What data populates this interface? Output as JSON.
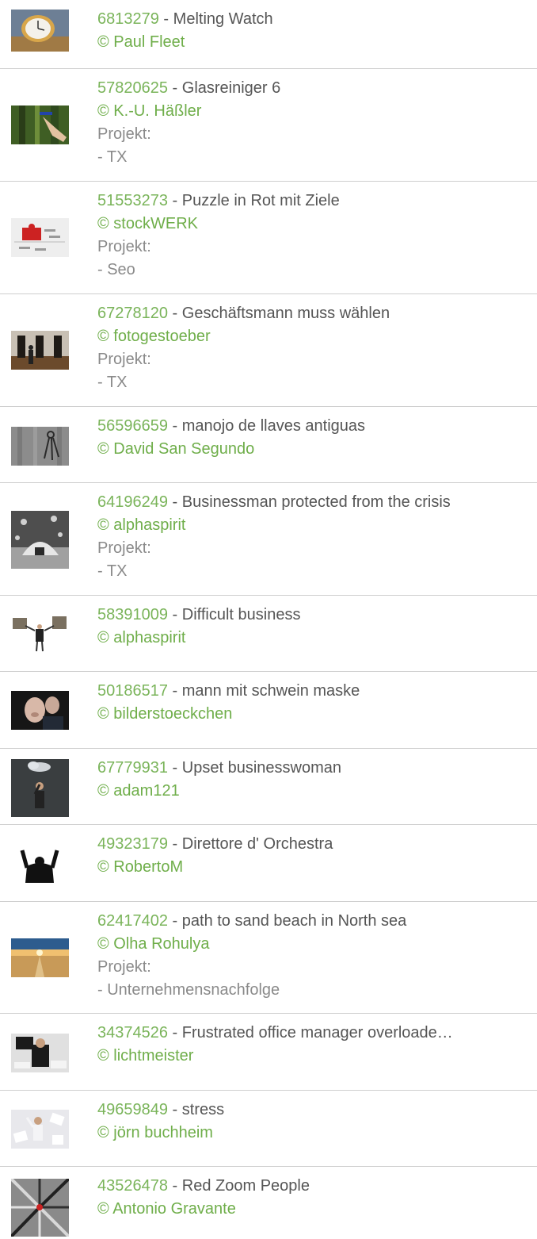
{
  "items": [
    {
      "id": "6813279",
      "title": "Melting Watch",
      "author": "© Paul Fleet",
      "icon": "melting-watch-thumbnail",
      "colors": [
        "#c9a66b",
        "#8a6a3a"
      ]
    },
    {
      "id": "57820625",
      "title": "Glasreiniger 6",
      "author": "© K.-U. Häßler",
      "project_label": "Projekt:",
      "project": "- TX",
      "icon": "glass-cleaner-thumbnail",
      "colors": [
        "#2f4a1e",
        "#6f8d3a"
      ]
    },
    {
      "id": "51553273",
      "title": "Puzzle in Rot mit Ziele",
      "author": "© stockWERK",
      "project_label": "Projekt:",
      "project": "- Seo",
      "icon": "puzzle-thumbnail",
      "colors": [
        "#eeeeee",
        "#cc2222"
      ]
    },
    {
      "id": "67278120",
      "title": "Geschäftsmann muss wählen",
      "author": "© fotogestoeber",
      "project_label": "Projekt:",
      "project": "- TX",
      "icon": "doors-thumbnail",
      "colors": [
        "#6b5a48",
        "#2a2520"
      ]
    },
    {
      "id": "56596659",
      "title": "manojo de llaves antiguas",
      "author": "© David San Segundo",
      "icon": "keys-thumbnail",
      "colors": [
        "#8c8c8c",
        "#3c3c3c"
      ]
    },
    {
      "id": "64196249",
      "title": "Businessman protected from the crisis",
      "author": "© alphaspirit",
      "project_label": "Projekt:",
      "project": "- TX",
      "icon": "businessman-shield-thumbnail",
      "colors": [
        "#5a5a5a",
        "#c8c8c8"
      ]
    },
    {
      "id": "58391009",
      "title": "Difficult business",
      "author": "© alphaspirit",
      "icon": "stones-thumbnail",
      "colors": [
        "#ffffff",
        "#7a7060"
      ]
    },
    {
      "id": "50186517",
      "title": "mann mit schwein maske",
      "author": "© bilderstoeckchen",
      "icon": "pig-mask-thumbnail",
      "colors": [
        "#1a1a1a",
        "#d8b8a8"
      ]
    },
    {
      "id": "67779931",
      "title": "Upset businesswoman",
      "author": "© adam121",
      "icon": "businesswoman-cloud-thumbnail",
      "colors": [
        "#3a3e40",
        "#d0d4d8"
      ]
    },
    {
      "id": "49323179",
      "title": "Direttore d' Orchestra",
      "author": "© RobertoM",
      "icon": "conductor-thumbnail",
      "colors": [
        "#ffffff",
        "#111111"
      ]
    },
    {
      "id": "62417402",
      "title": "path to sand beach in North sea",
      "author": "© Olha Rohulya",
      "project_label": "Projekt:",
      "project": "- Unternehmensnachfolge",
      "icon": "beach-thumbnail",
      "colors": [
        "#2d5c8e",
        "#d9b070"
      ]
    },
    {
      "id": "34374526",
      "title": "Frustrated office manager overloade…",
      "author": "© lichtmeister",
      "icon": "office-manager-thumbnail",
      "colors": [
        "#e0e0e0",
        "#1a1a1a"
      ]
    },
    {
      "id": "49659849",
      "title": "stress",
      "author": "© jörn buchheim",
      "icon": "stress-paper-thumbnail",
      "colors": [
        "#e8e8ec",
        "#9aa0b0"
      ]
    },
    {
      "id": "43526478",
      "title": "Red Zoom People",
      "author": "© Antonio Gravante",
      "icon": "zoom-people-thumbnail",
      "colors": [
        "#c0c0c0",
        "#202020"
      ]
    }
  ]
}
